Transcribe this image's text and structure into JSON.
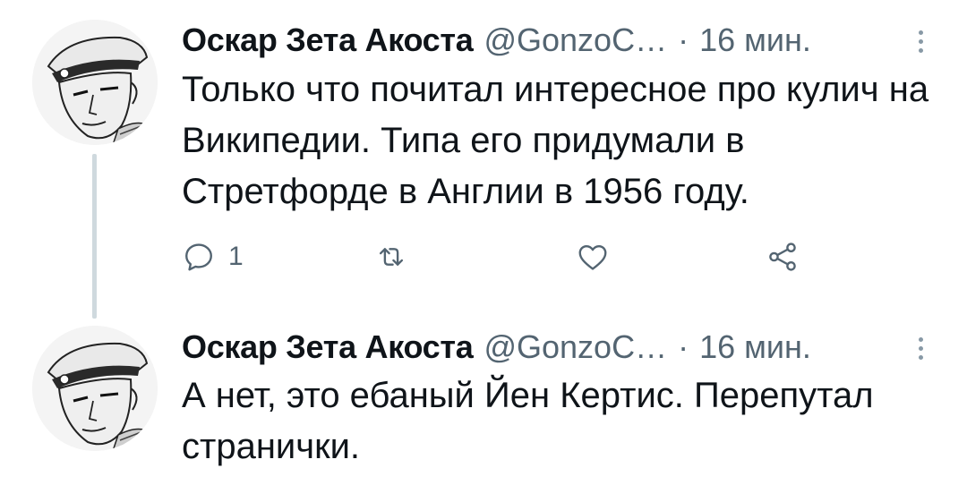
{
  "tweets": [
    {
      "author": {
        "name": "Оскар Зета Акоста",
        "handle": "@GonzoC…",
        "avatar_icon": "avatar-sailor-illustration"
      },
      "separator": "·",
      "time": "16 мин.",
      "text": "Только что почитал интересное про кулич на Википедии. Типа его придумали в Стретфорде в Англии в 1956 году.",
      "actions": {
        "reply_icon": "reply-icon",
        "reply_count": "1",
        "retweet_icon": "retweet-icon",
        "like_icon": "heart-icon",
        "share_icon": "share-icon"
      }
    },
    {
      "author": {
        "name": "Оскар Зета Акоста",
        "handle": "@GonzoC…",
        "avatar_icon": "avatar-sailor-illustration"
      },
      "separator": "·",
      "time": "16 мин.",
      "text": "А нет, это ебаный Йен Кертис. Перепутал странички."
    }
  ],
  "colors": {
    "text_primary": "#0f1419",
    "text_secondary": "#536471",
    "thread_line": "#cfd9de"
  }
}
